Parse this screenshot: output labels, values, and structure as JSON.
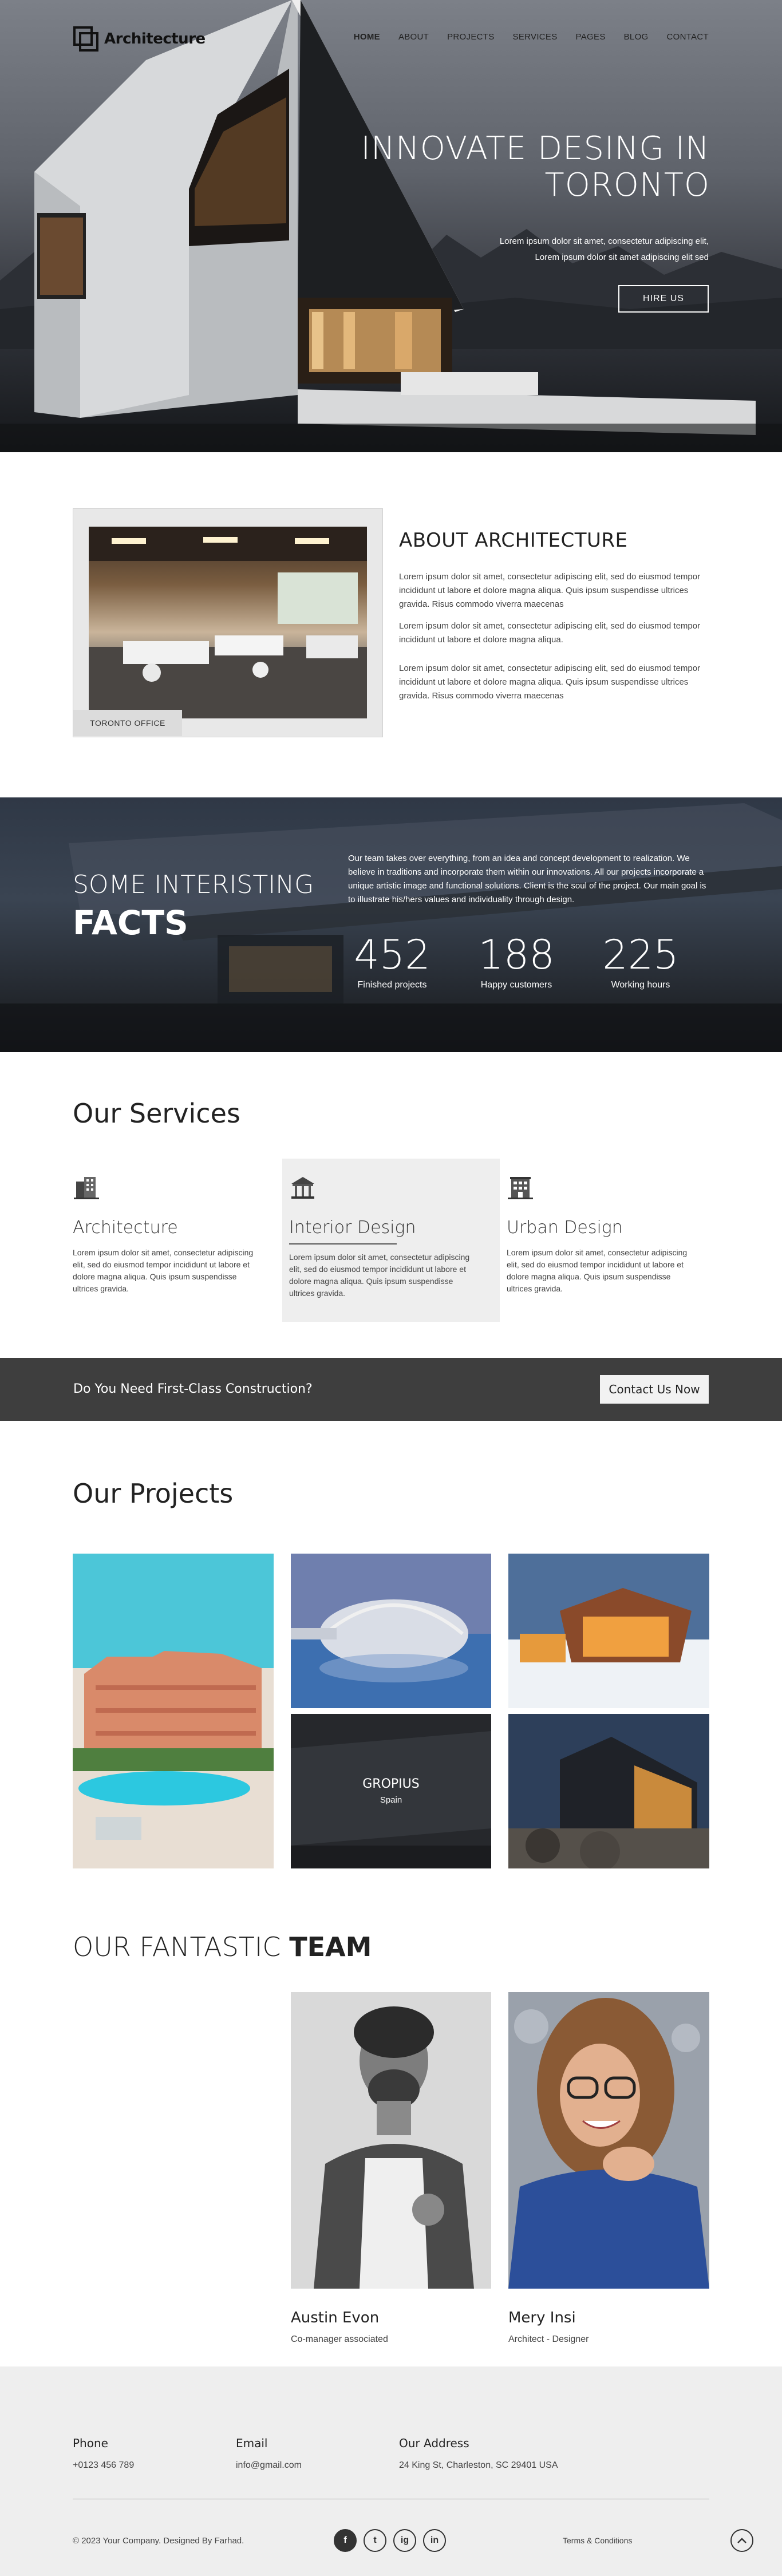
{
  "header": {
    "brand": "Architecture",
    "nav": [
      "HOME",
      "ABOUT",
      "PROJECTS",
      "SERVICES",
      "PAGES",
      "BLOG",
      "CONTACT"
    ],
    "active": "HOME"
  },
  "hero": {
    "title_line1": "INNOVATE DESING IN",
    "title_line2": "TORONTO",
    "sub_line1": "Lorem ipsum dolor sit amet, consectetur adipiscing elit,",
    "sub_line2": "Lorem ipsum dolor sit amet adipiscing elit sed",
    "button": "HIRE US"
  },
  "about": {
    "title": "ABOUT ARCHITECTURE",
    "image_tag": "TORONTO OFFICE",
    "paragraphs": [
      "Lorem ipsum dolor sit amet, consectetur adipiscing elit, sed do eiusmod tempor incididunt ut labore et dolore magna aliqua. Quis ipsum suspendisse ultrices gravida.  Risus commodo viverra maecenas",
      "Lorem ipsum dolor sit amet, consectetur adipiscing elit, sed do eiusmod tempor incididunt ut labore et dolore magna aliqua.",
      "Lorem ipsum dolor sit amet, consectetur adipiscing elit, sed do eiusmod tempor incididunt ut labore et dolore magna aliqua. Quis ipsum suspendisse ultrices gravida.  Risus commodo viverra maecenas"
    ]
  },
  "facts": {
    "title_line1": "SOME INTERISTING",
    "title_line2": "FACTS",
    "description": "Our team takes over everything, from an idea and concept development to realization. We believe in traditions and incorporate them within our innovations. All our projects incorporate a unique artistic image and functional solutions. Client is the soul of the project. Our main goal is to illustrate his/hers values and individuality through design.",
    "stats": [
      {
        "number": "452",
        "label": "Finished projects"
      },
      {
        "number": "188",
        "label": "Happy customers"
      },
      {
        "number": "225",
        "label": "Working hours"
      }
    ]
  },
  "services": {
    "title": "Our Services",
    "items": [
      {
        "name": "Architecture",
        "icon": "building-icon",
        "text": "Lorem ipsum dolor sit amet, consectetur adipiscing elit, sed do eiusmod tempor incididunt ut labore et dolore magna aliqua. Quis ipsum suspendisse ultrices gravida."
      },
      {
        "name": "Interior Design",
        "icon": "pavilion-icon",
        "text": "Lorem ipsum dolor sit amet, consectetur adipiscing elit, sed do eiusmod tempor incididunt ut labore et dolore magna aliqua. Quis ipsum suspendisse ultrices gravida."
      },
      {
        "name": "Urban Design",
        "icon": "office-building-icon",
        "text": "Lorem ipsum dolor sit amet, consectetur adipiscing elit, sed do eiusmod tempor incididunt ut labore et dolore magna aliqua. Quis ipsum suspendisse ultrices gravida."
      }
    ]
  },
  "cta": {
    "text": "Do You Need First-Class Construction?",
    "button": "Contact Us Now"
  },
  "projects": {
    "title": "Our Projects",
    "featured_name": "GROPIUS",
    "featured_place": "Spain"
  },
  "team": {
    "title_light": "OUR FANTASTIC",
    "title_bold": "TEAM",
    "members": [
      {
        "name": "Austin Evon",
        "role": "Co-manager associated"
      },
      {
        "name": "Mery Insi",
        "role": "Architect - Designer"
      }
    ]
  },
  "footer": {
    "phone_label": "Phone",
    "phone": "+0123 456 789",
    "email_label": "Email",
    "email": "info@gmail.com",
    "address_label": "Our Address",
    "address": "24 King St, Charleston, SC 29401 USA",
    "copyright": "© 2023 Your Company. Designed By Farhad.",
    "terms": "Terms & Conditions",
    "social": [
      "f",
      "t",
      "ig",
      "in"
    ]
  },
  "colors": {
    "dark_band": "#3e3e3e",
    "footer_bg": "#eeeeee",
    "highlight_card": "#eeeeee"
  }
}
